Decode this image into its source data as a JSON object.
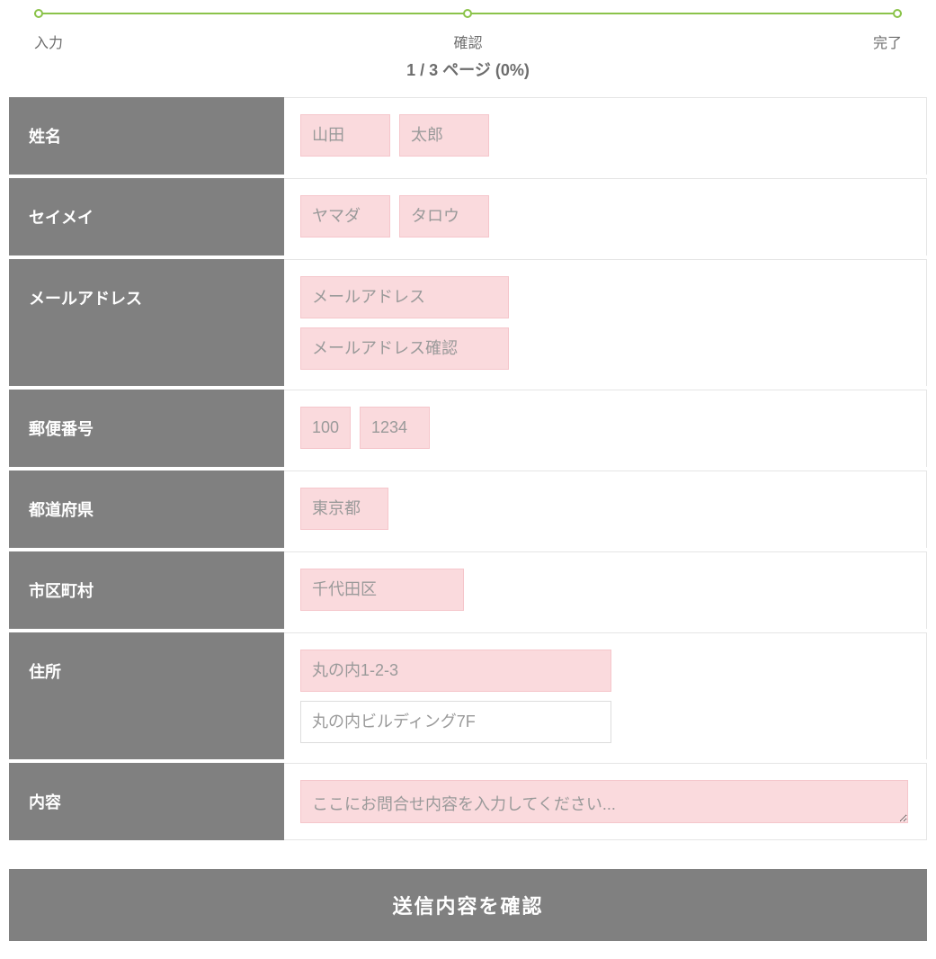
{
  "progress": {
    "steps": [
      "入力",
      "確認",
      "完了"
    ],
    "page_indicator": "1 / 3 ページ (0%)"
  },
  "form": {
    "name": {
      "label": "姓名",
      "last_ph": "山田",
      "first_ph": "太郎"
    },
    "kana": {
      "label": "セイメイ",
      "last_ph": "ヤマダ",
      "first_ph": "タロウ"
    },
    "email": {
      "label": "メールアドレス",
      "email_ph": "メールアドレス",
      "confirm_ph": "メールアドレス確認"
    },
    "zip": {
      "label": "郵便番号",
      "zip3_ph": "100",
      "zip4_ph": "1234"
    },
    "pref": {
      "label": "都道府県",
      "ph": "東京都"
    },
    "city": {
      "label": "市区町村",
      "ph": "千代田区"
    },
    "address": {
      "label": "住所",
      "line1_ph": "丸の内1-2-3",
      "line2_ph": "丸の内ビルディング7F"
    },
    "content": {
      "label": "内容",
      "ph": "ここにお問合せ内容を入力してください..."
    }
  },
  "submit": {
    "label": "送信内容を確認"
  }
}
